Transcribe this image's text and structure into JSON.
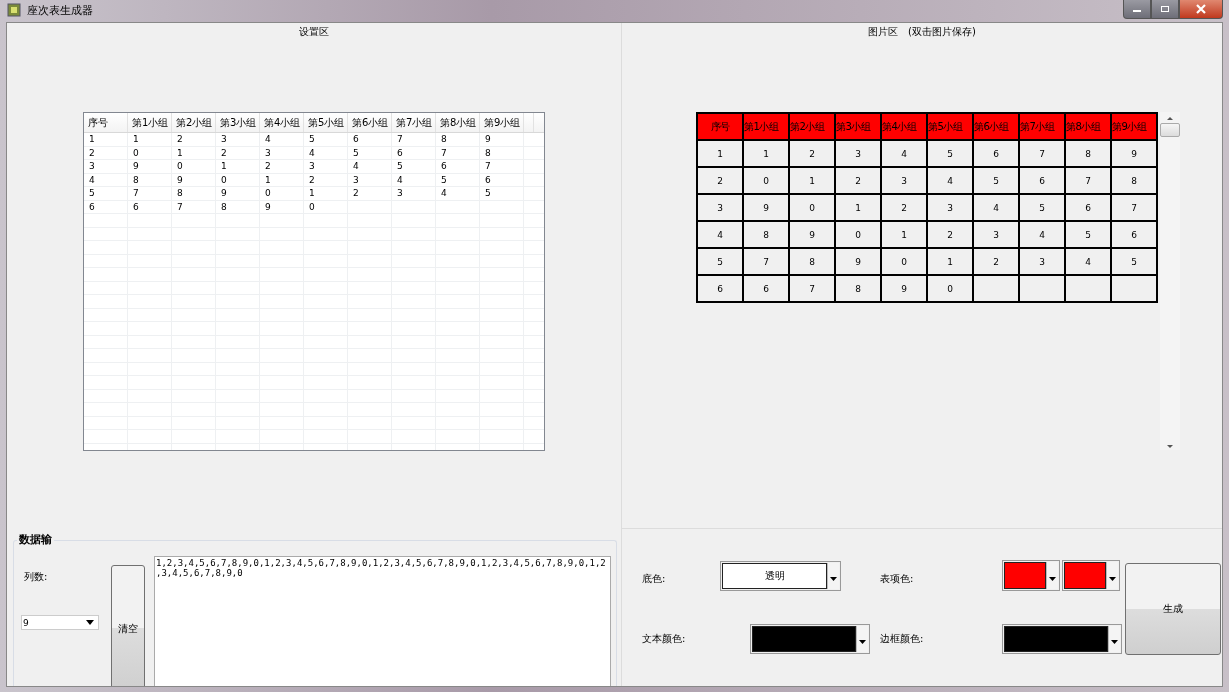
{
  "window": {
    "title": "座次表生成器"
  },
  "settings_panel": {
    "title": "设置区",
    "grid": {
      "columns": [
        "序号",
        "第1小组",
        "第2小组",
        "第3小组",
        "第4小组",
        "第5小组",
        "第6小组",
        "第7小组",
        "第8小组",
        "第9小组"
      ],
      "rows": [
        [
          "1",
          "1",
          "2",
          "3",
          "4",
          "5",
          "6",
          "7",
          "8",
          "9"
        ],
        [
          "2",
          "0",
          "1",
          "2",
          "3",
          "4",
          "5",
          "6",
          "7",
          "8"
        ],
        [
          "3",
          "9",
          "0",
          "1",
          "2",
          "3",
          "4",
          "5",
          "6",
          "7"
        ],
        [
          "4",
          "8",
          "9",
          "0",
          "1",
          "2",
          "3",
          "4",
          "5",
          "6"
        ],
        [
          "5",
          "7",
          "8",
          "9",
          "0",
          "1",
          "2",
          "3",
          "4",
          "5"
        ],
        [
          "6",
          "6",
          "7",
          "8",
          "9",
          "0"
        ]
      ]
    }
  },
  "image_panel": {
    "title": "图片区　(双击图片保存)",
    "table": {
      "columns": [
        "序号",
        "第1小组",
        "第2小组",
        "第3小组",
        "第4小组",
        "第5小组",
        "第6小组",
        "第7小组",
        "第8小组",
        "第9小组"
      ],
      "rows": [
        [
          "1",
          "1",
          "2",
          "3",
          "4",
          "5",
          "6",
          "7",
          "8",
          "9"
        ],
        [
          "2",
          "0",
          "1",
          "2",
          "3",
          "4",
          "5",
          "6",
          "7",
          "8"
        ],
        [
          "3",
          "9",
          "0",
          "1",
          "2",
          "3",
          "4",
          "5",
          "6",
          "7"
        ],
        [
          "4",
          "8",
          "9",
          "0",
          "1",
          "2",
          "3",
          "4",
          "5",
          "6"
        ],
        [
          "5",
          "7",
          "8",
          "9",
          "0",
          "1",
          "2",
          "3",
          "4",
          "5"
        ],
        [
          "6",
          "6",
          "7",
          "8",
          "9",
          "0"
        ]
      ]
    }
  },
  "data_input": {
    "title": "数据输",
    "column_count_label": "列数:",
    "column_count": "9",
    "clear_button": "清空",
    "text": "1,2,3,4,5,6,7,8,9,0,1,2,3,4,5,6,7,8,9,0,1,2,3,4,5,6,7,8,9,0,1,2,3,4,5,6,7,8,9,0,1,2,3,4,5,6,7,8,9,0"
  },
  "style_settings": {
    "background": {
      "label": "底色:",
      "value": "透明"
    },
    "header_colors": {
      "label": "表项色:",
      "colors": [
        {
          "color": "#ff0000"
        },
        {
          "color": "#ff0000"
        }
      ]
    },
    "text_color": {
      "label": "文本颜色:",
      "color": "#000000"
    },
    "border_color": {
      "label": "边框颜色:",
      "color": "#000000"
    },
    "generate_button": "生成"
  }
}
